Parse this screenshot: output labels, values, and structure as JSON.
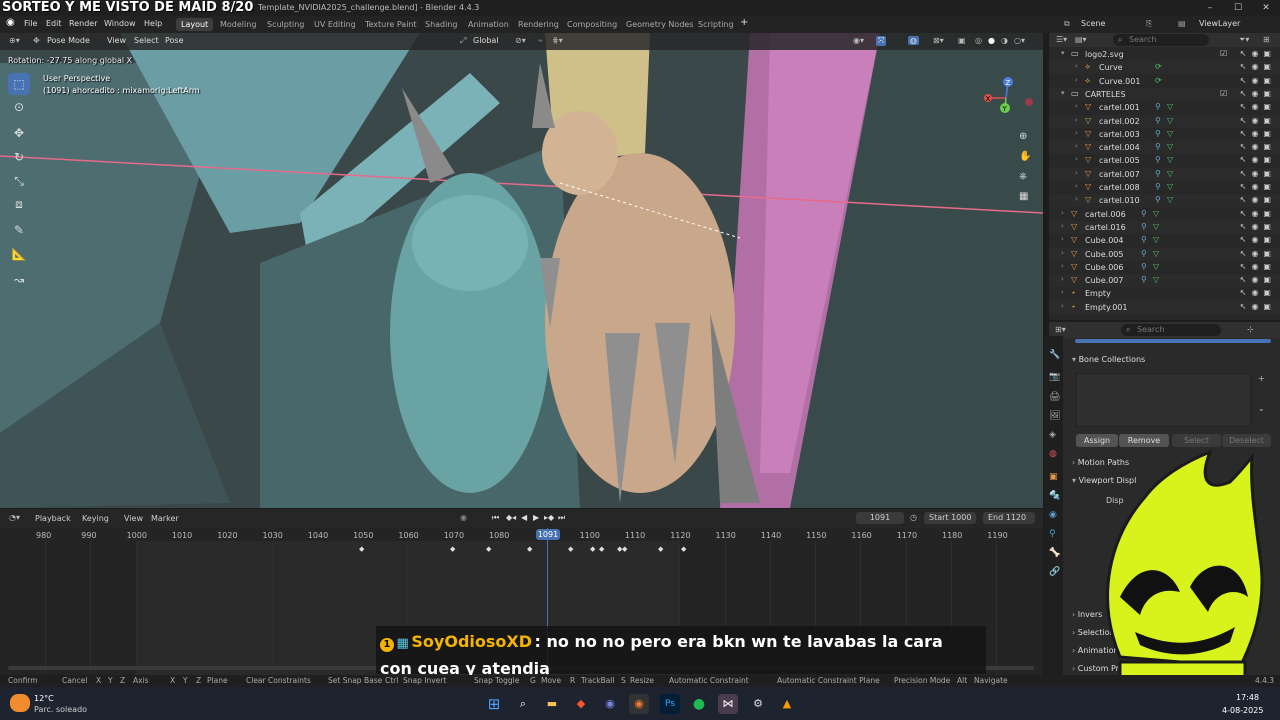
{
  "stream": {
    "title": "SORTEO Y ME VISTO DE MAID 8/20"
  },
  "window": {
    "app_title": "Template_NVIDIA2025_challenge.blend] - Blender 4.4.3",
    "controls": [
      "–",
      "☐",
      "✕"
    ]
  },
  "menu": {
    "items": [
      "File",
      "Edit",
      "Render",
      "Window",
      "Help"
    ],
    "workspaces": [
      "Layout",
      "Modeling",
      "Sculpting",
      "UV Editing",
      "Texture Paint",
      "Shading",
      "Animation",
      "Rendering",
      "Compositing",
      "Geometry Nodes",
      "Scripting"
    ],
    "active_workspace": "Layout",
    "add_tab": "+",
    "scene": "Scene",
    "view_layer": "ViewLayer"
  },
  "viewport": {
    "mode": "Pose Mode",
    "menus": [
      "View",
      "Select",
      "Pose"
    ],
    "orientation": "Global",
    "rotation_status": "Rotation: -27.75 along global X",
    "perspective": "User Perspective",
    "object_info": "(1091) ahorcadito : mixamorig:LeftArm",
    "axis_labels": [
      "Z",
      "X",
      "Y"
    ]
  },
  "outliner": {
    "search_placeholder": "Search",
    "rows": [
      {
        "label": "logo2.svg",
        "indent": 1,
        "type": "collection"
      },
      {
        "label": "Curve",
        "indent": 2,
        "type": "curve"
      },
      {
        "label": "Curve.001",
        "indent": 2,
        "type": "curve"
      },
      {
        "label": "CARTELES",
        "indent": 1,
        "type": "collection"
      },
      {
        "label": "cartel.001",
        "indent": 2,
        "type": "mesh"
      },
      {
        "label": "cartel.002",
        "indent": 2,
        "type": "mesh"
      },
      {
        "label": "cartel.003",
        "indent": 2,
        "type": "mesh"
      },
      {
        "label": "cartel.004",
        "indent": 2,
        "type": "mesh"
      },
      {
        "label": "cartel.005",
        "indent": 2,
        "type": "mesh"
      },
      {
        "label": "cartel.007",
        "indent": 2,
        "type": "mesh"
      },
      {
        "label": "cartel.008",
        "indent": 2,
        "type": "mesh"
      },
      {
        "label": "cartel.010",
        "indent": 2,
        "type": "mesh"
      },
      {
        "label": "cartel.006",
        "indent": 1,
        "type": "mesh"
      },
      {
        "label": "cartel.016",
        "indent": 1,
        "type": "mesh"
      },
      {
        "label": "Cube.004",
        "indent": 1,
        "type": "mesh"
      },
      {
        "label": "Cube.005",
        "indent": 1,
        "type": "mesh"
      },
      {
        "label": "Cube.006",
        "indent": 1,
        "type": "mesh"
      },
      {
        "label": "Cube.007",
        "indent": 1,
        "type": "mesh"
      },
      {
        "label": "Empty",
        "indent": 1,
        "type": "empty"
      },
      {
        "label": "Empty.001",
        "indent": 1,
        "type": "empty"
      }
    ]
  },
  "properties": {
    "search_placeholder": "Search",
    "bone_collections": "Bone Collections",
    "buttons": [
      "Assign",
      "Remove",
      "Select",
      "Deselect"
    ],
    "panels": [
      "Motion Paths",
      "Viewport Display",
      "Inverse Kinematics",
      "Selection",
      "Animation",
      "Custom Properties"
    ],
    "panel_partials": {
      "viewport_display": "Viewport Displ",
      "display": "Disp",
      "inverse": "Invers",
      "selection": "Selection",
      "animation": "Animation",
      "custom": "Custom Propert"
    }
  },
  "timeline": {
    "menus": [
      "Playback",
      "Keying",
      "View",
      "Marker"
    ],
    "current_frame": "1091",
    "start_label": "Start",
    "start": "1000",
    "end_label": "End",
    "end": "1120",
    "ticks": [
      "980",
      "990",
      "1000",
      "1010",
      "1020",
      "1030",
      "1040",
      "1050",
      "1060",
      "1070",
      "1080",
      "1091",
      "1100",
      "1110",
      "1120",
      "1130",
      "1140",
      "1150",
      "1160",
      "1170",
      "1180",
      "1190"
    ]
  },
  "chat": {
    "badge": "1",
    "user": "SoyOdiosoXD",
    "message": ": no no no pero era bkn wn te lavabas la cara con cuea y atendia"
  },
  "statusbar": {
    "items": [
      "Confirm",
      "Cancel",
      "X",
      "Y",
      "Z",
      "Axis",
      "X",
      "Y",
      "Z",
      "Plane",
      "Clear Constraints",
      "Set Snap Base",
      "Ctrl",
      "Snap Invert",
      "Snap Toggle",
      "G",
      "Move",
      "R",
      "TrackBall",
      "S",
      "Resize",
      "Automatic Constraint",
      "Automatic Constraint Plane",
      "Precision Mode",
      "Alt",
      "Navigate"
    ],
    "version": "4.4.3"
  },
  "taskbar": {
    "weather_temp": "12°C",
    "weather_desc": "Parc. soleado",
    "time": "17:48",
    "date": "4-08-2025"
  },
  "colors": {
    "accent": "#4772b3",
    "timeline_cursor": "#4772b3",
    "orange": "#e39b4a",
    "green": "#55c46a",
    "chat_user": "#f5b400"
  }
}
